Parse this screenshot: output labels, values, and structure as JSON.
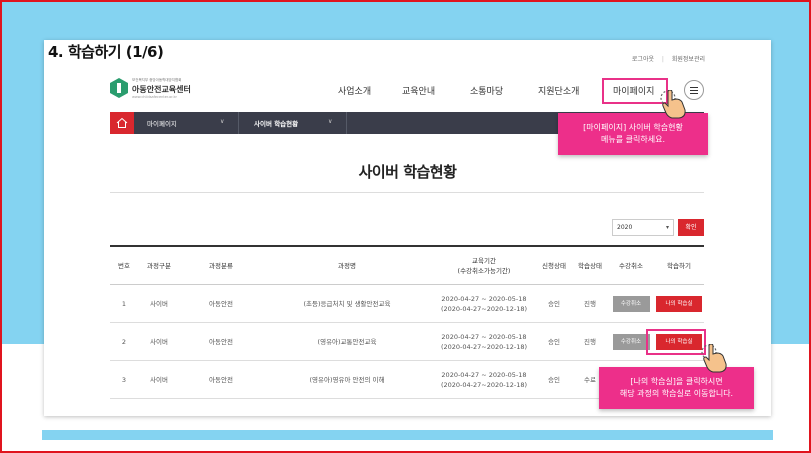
{
  "slide_title": "4. 학습하기 (1/6)",
  "util_links": [
    "로그아웃",
    "회원정보관리"
  ],
  "logo": {
    "small_text": "보건복지부 중앙아동학대방지협회",
    "name": "아동안전교육센터",
    "url": "www.childsafecenter.or.kr"
  },
  "gnb": [
    "사업소개",
    "교육안내",
    "소통마당",
    "지원단소개",
    "마이페이지"
  ],
  "lnb": {
    "item1": "마이페이지",
    "item2": "사이버 학습현황"
  },
  "page_title": "사이버 학습현황",
  "filter": {
    "year": "2020",
    "confirm": "확인"
  },
  "table": {
    "headers": [
      "번호",
      "과정구분",
      "과정분류",
      "과정명",
      "교육기간\n(수강취소가능기간)",
      "신청상태",
      "학습상태",
      "수강취소",
      "학습하기"
    ],
    "rows": [
      {
        "no": "1",
        "type": "사이버",
        "category": "아동안전",
        "name": "(초등)응급처치 및 생활안전교육",
        "period1": "2020-04-27 ~ 2020-05-18",
        "period2": "(2020-04-27~2020-12-18)",
        "apply": "승인",
        "status": "진행",
        "cancel": "수강취소",
        "study": "나의 학습실"
      },
      {
        "no": "2",
        "type": "사이버",
        "category": "아동안전",
        "name": "(영유아)교통안전교육",
        "period1": "2020-04-27 ~ 2020-05-18",
        "period2": "(2020-04-27~2020-12-18)",
        "apply": "승인",
        "status": "진행",
        "cancel": "수강취소",
        "study": "나의 학습실"
      },
      {
        "no": "3",
        "type": "사이버",
        "category": "아동안전",
        "name": "(영유아)영유아 안전의 이해",
        "period1": "2020-04-27 ~ 2020-05-18",
        "period2": "(2020-04-27~2020-12-18)",
        "apply": "승인",
        "status": "수료",
        "cancel": "",
        "study": ""
      }
    ]
  },
  "callout_top": {
    "line1": "[마이페이지] 사이버 학습현황",
    "line2": "메뉴를 클릭하세요."
  },
  "callout_bottom": {
    "line1": "[나의 학습실]을 클릭하시면",
    "line2": "해당 과정의 학습실로 이동합니다."
  },
  "colors": {
    "accent": "#d9272e",
    "callout": "#ed2f8a",
    "sky": "#84d3f1",
    "nav_dark": "#3a3d4a"
  }
}
